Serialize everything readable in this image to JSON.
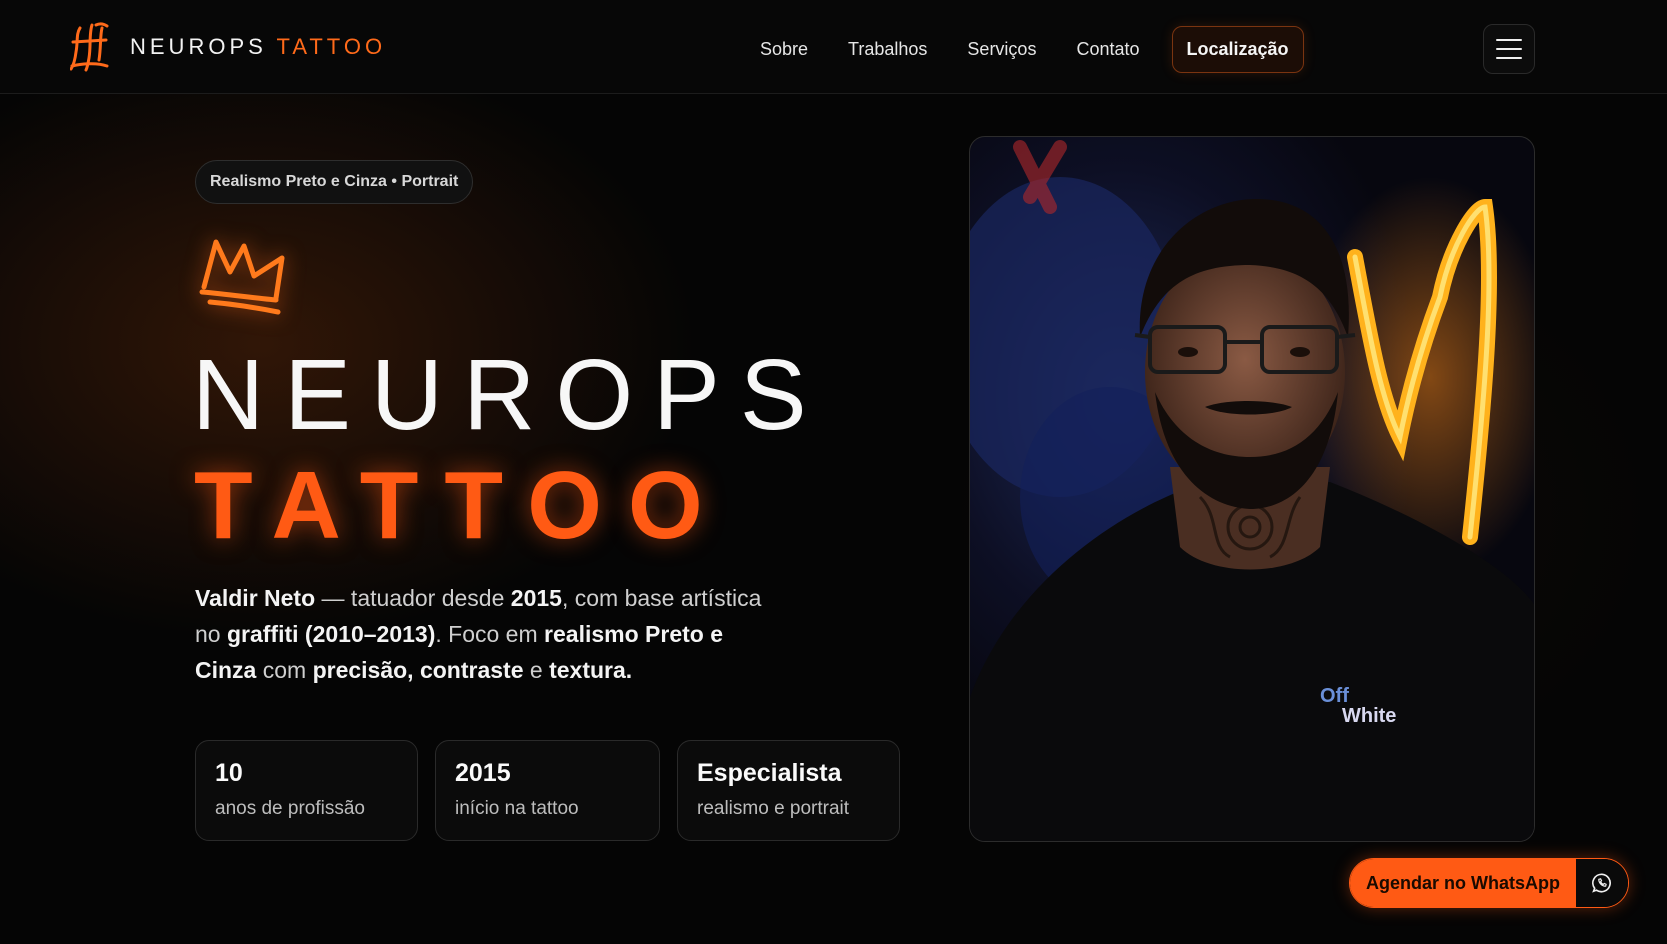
{
  "header": {
    "logo_word": "NEUROPS",
    "logo_accent": "TATTOO",
    "nav": [
      "Sobre",
      "Trabalhos",
      "Serviços",
      "Contato"
    ],
    "location_button": "Localização",
    "menu_icon": "hamburger-icon"
  },
  "hero": {
    "tag": "Realismo Preto e Cinza • Portrait",
    "crown_icon": "crown-icon",
    "title_line1": "NEUROPS",
    "title_line2": "TATTOO",
    "description": {
      "p1": "Valdir Neto",
      "p2": " — tatuador desde ",
      "p3": "2015",
      "p4": ", com base artística no ",
      "p5": "graffiti (2010–2013)",
      "p6": ". Foco em ",
      "p7": "realismo Preto e Cinza",
      "p8": " com ",
      "p9": "precisão, contraste",
      "p10": " e ",
      "p11": "textura."
    },
    "stats": [
      {
        "value": "10",
        "label": "anos de profissão"
      },
      {
        "value": "2015",
        "label": "início na tattoo"
      },
      {
        "value": "Especialista",
        "label": "realismo e portrait"
      }
    ],
    "photo_shirt_text_1": "Off",
    "photo_shirt_text_2": "White"
  },
  "whatsapp": {
    "label": "Agendar no WhatsApp",
    "icon": "whatsapp-icon"
  },
  "colors": {
    "accent": "#ff5a14",
    "background": "#050505"
  }
}
